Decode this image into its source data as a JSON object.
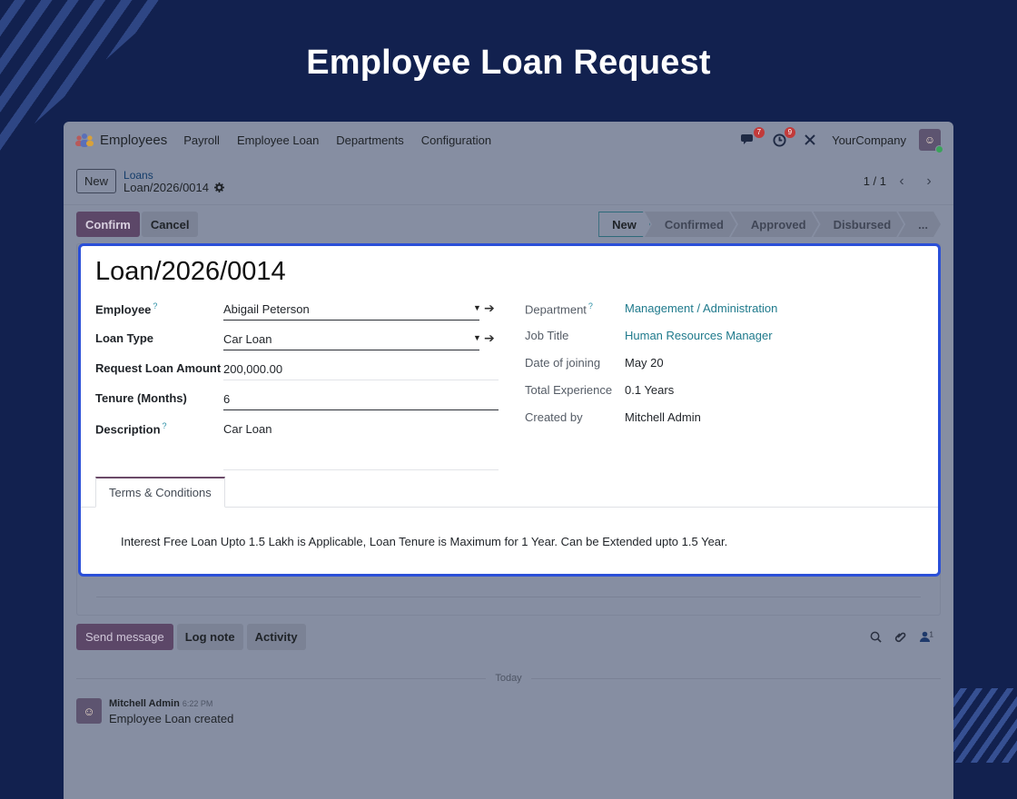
{
  "banner": {
    "title": "Employee Loan Request"
  },
  "navbar": {
    "app_name": "Employees",
    "menus": [
      "Payroll",
      "Employee Loan",
      "Departments",
      "Configuration"
    ],
    "messages_count": "7",
    "activities_count": "9",
    "company": "YourCompany"
  },
  "control_panel": {
    "new_label": "New",
    "breadcrumb_parent": "Loans",
    "breadcrumb_current": "Loan/2026/0014",
    "pager": "1 / 1"
  },
  "actions": {
    "confirm_label": "Confirm",
    "cancel_label": "Cancel"
  },
  "statusbar": {
    "stages": [
      "New",
      "Confirmed",
      "Approved",
      "Disbursed"
    ],
    "active_stage": "New",
    "more_label": "..."
  },
  "form": {
    "title": "Loan/2026/0014",
    "left": {
      "employee_label": "Employee",
      "employee_value": "Abigail Peterson",
      "loan_type_label": "Loan Type",
      "loan_type_value": "Car Loan",
      "amount_label": "Request Loan Amount",
      "amount_value": "200,000.00",
      "tenure_label": "Tenure (Months)",
      "tenure_value": "6",
      "description_label": "Description",
      "description_value": "Car Loan"
    },
    "right": {
      "department_label": "Department",
      "department_value": "Management / Administration",
      "job_title_label": "Job Title",
      "job_title_value": "Human Resources Manager",
      "doj_label": "Date of joining",
      "doj_value": "May 20",
      "experience_label": "Total Experience",
      "experience_value": "0.1 Years",
      "created_by_label": "Created by",
      "created_by_value": "Mitchell Admin"
    },
    "tab_label": "Terms & Conditions",
    "terms_text": "Interest Free Loan Upto 1.5 Lakh is Applicable, Loan Tenure is Maximum for 1 Year. Can be Extended upto 1.5 Year."
  },
  "chatter": {
    "send_message": "Send message",
    "log_note": "Log note",
    "activity": "Activity",
    "followers_count": "1",
    "date_separator": "Today",
    "message": {
      "author": "Mitchell Admin",
      "time": "6:22 PM",
      "body": "Employee Loan created"
    }
  },
  "colors": {
    "background": "#12214f",
    "highlight_border": "#2a4fd8",
    "primary_button": "#5c4768",
    "link": "#1f7a8c"
  }
}
